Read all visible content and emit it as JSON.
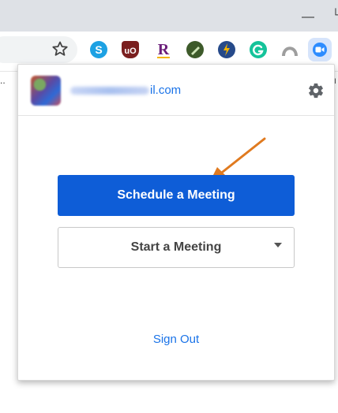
{
  "browser": {
    "window_minimize": "—",
    "bookmarks_overflow": ".."
  },
  "extensions": [
    {
      "name": "skype-icon",
      "color": "#1da1e3",
      "glyph": "S"
    },
    {
      "name": "ublock-icon",
      "color": "#7a1f1f",
      "glyph": "ʊ"
    },
    {
      "name": "r-extension-icon",
      "color": "#6b1f7a",
      "glyph": "R"
    },
    {
      "name": "green-pen-icon",
      "color": "#3d5a2a",
      "glyph": "✎"
    },
    {
      "name": "lightning-icon",
      "color": "#f4b400",
      "glyph": "ϟ"
    },
    {
      "name": "grammarly-icon",
      "color": "#15c39a",
      "glyph": "G"
    },
    {
      "name": "gray-arch-icon",
      "color": "#9e9e9e",
      "glyph": "∩"
    },
    {
      "name": "zoom-icon",
      "color": "#2d8cff",
      "glyph": "▶"
    }
  ],
  "popup": {
    "email_suffix": "il.com",
    "schedule_label": "Schedule a Meeting",
    "start_label": "Start a Meeting",
    "signout_label": "Sign Out"
  },
  "colors": {
    "accent": "#0e5dd7",
    "link": "#1a73e8",
    "annotation_arrow": "#e07a1f"
  }
}
